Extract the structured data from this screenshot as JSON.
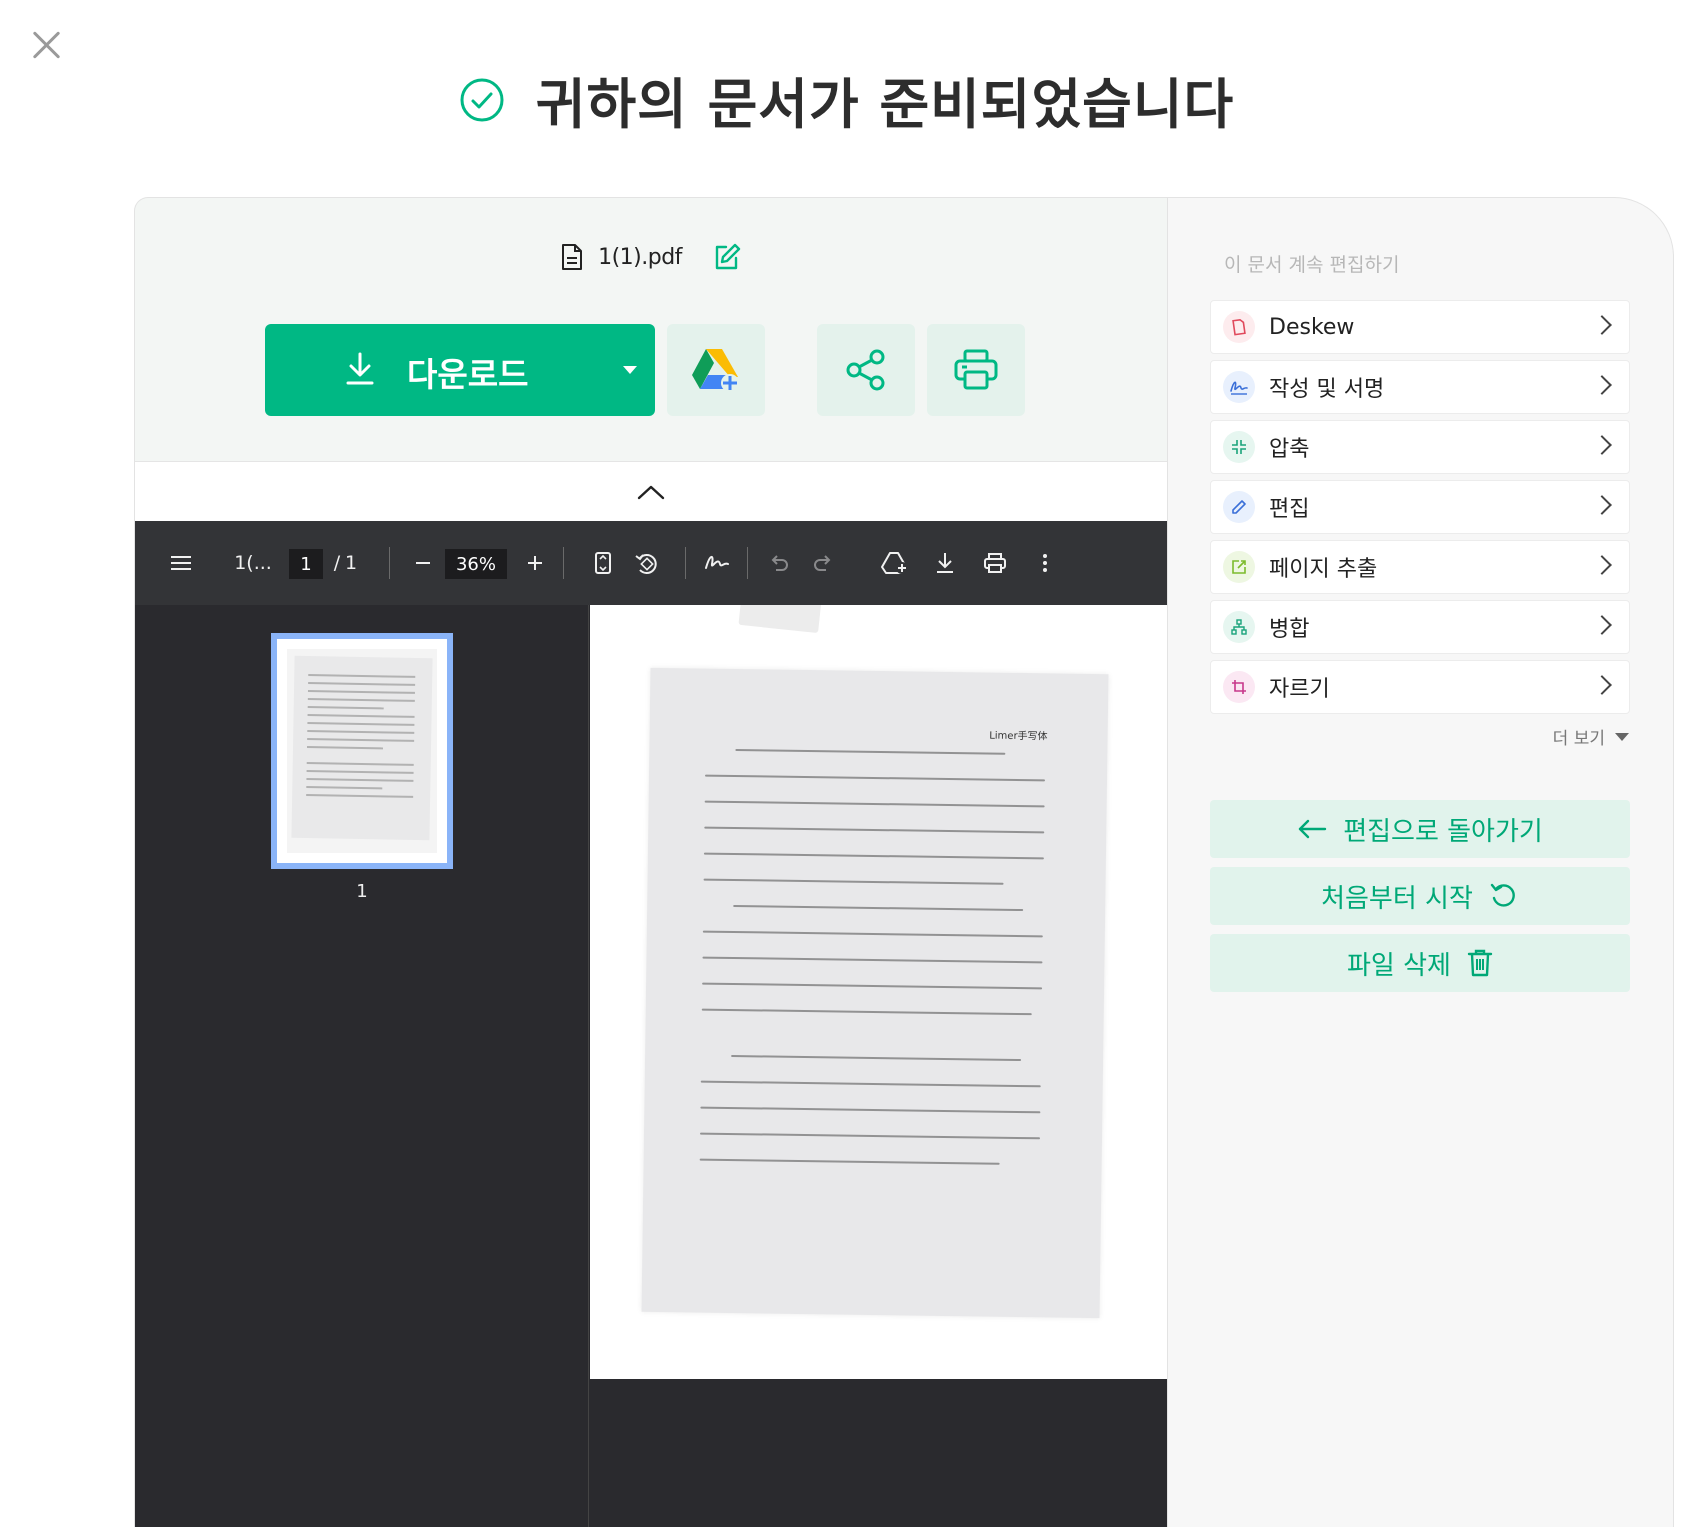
{
  "header": {
    "title": "귀하의 문서가 준비되었습니다"
  },
  "file": {
    "name": "1(1).pdf"
  },
  "actions": {
    "download_label": "다운로드"
  },
  "viewer": {
    "doc_title": "1(...",
    "current_page": "1",
    "page_separator": "/",
    "total_pages": "1",
    "zoom": "36%",
    "thumbnail_label": "1",
    "paper_header": "Limer手写体"
  },
  "right_panel": {
    "title": "이 문서 계속 편집하기",
    "tools": [
      {
        "label": "Deskew",
        "icon": "deskew-icon",
        "color": "#e0495c",
        "bg": "#fdecee"
      },
      {
        "label": "작성 및 서명",
        "icon": "sign-icon",
        "color": "#3a6fd8",
        "bg": "#e8f0fd"
      },
      {
        "label": "압축",
        "icon": "compress-icon",
        "color": "#19a37a",
        "bg": "#e6f6f0"
      },
      {
        "label": "편집",
        "icon": "pencil-icon",
        "color": "#3a6fd8",
        "bg": "#e8f0fd"
      },
      {
        "label": "페이지 추출",
        "icon": "extract-icon",
        "color": "#7cbb2c",
        "bg": "#eef7e2"
      },
      {
        "label": "병합",
        "icon": "merge-icon",
        "color": "#19a37a",
        "bg": "#e6f6f0"
      },
      {
        "label": "자르기",
        "icon": "crop-icon",
        "color": "#c8388b",
        "bg": "#fbe8f3"
      }
    ],
    "more_label": "더 보기",
    "back_label": "편집으로 돌아가기",
    "restart_label": "처음부터 시작",
    "delete_label": "파일 삭제"
  },
  "colors": {
    "accent": "#00b884",
    "accent_light": "#e1f3ec",
    "viewer_bg": "#2a2a2e",
    "toolbar_bg": "#333437"
  }
}
